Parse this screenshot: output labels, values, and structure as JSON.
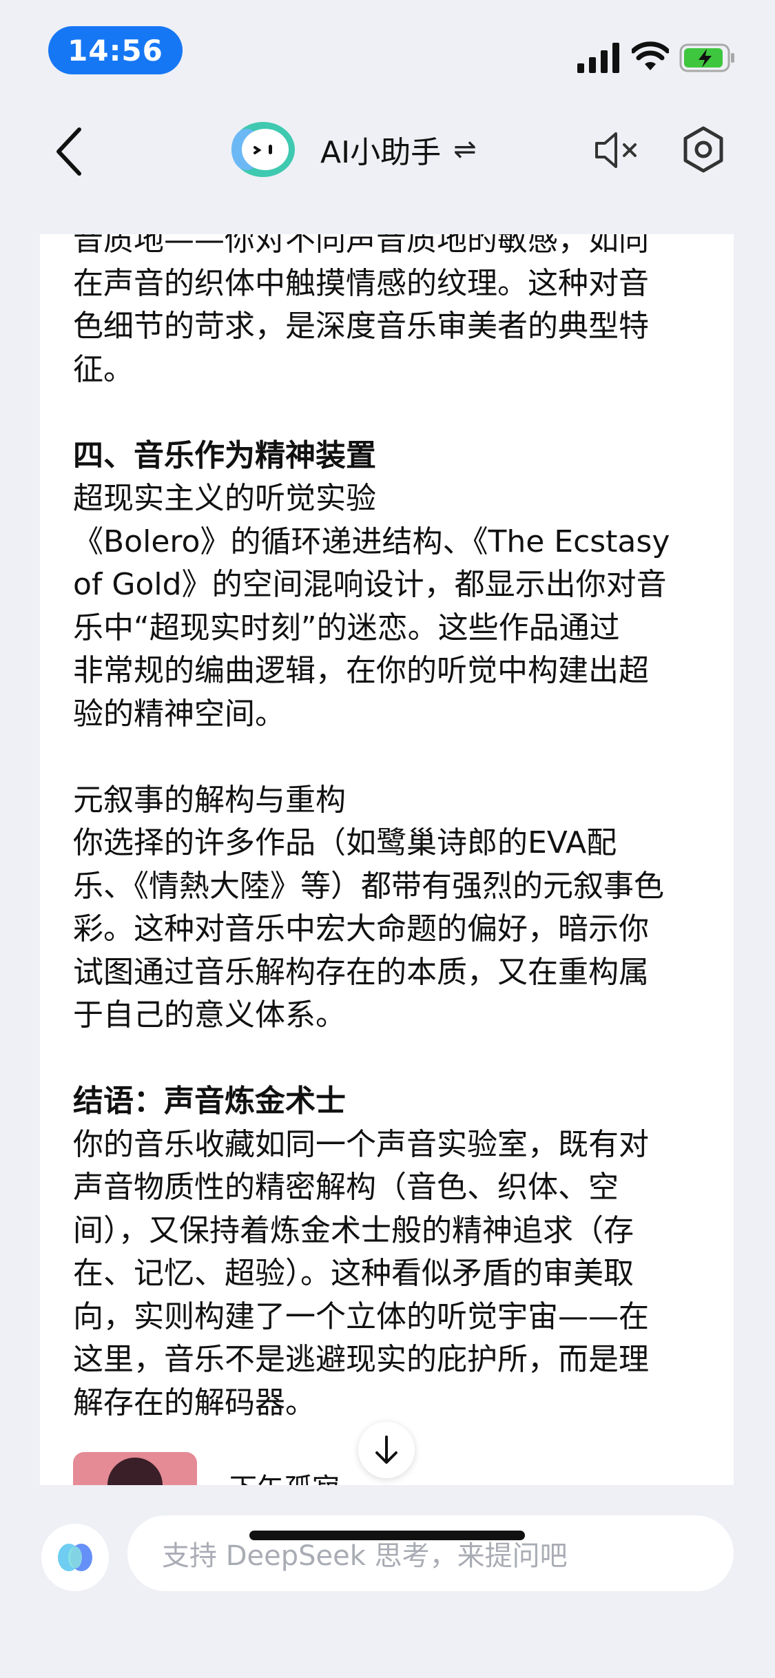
{
  "status": {
    "time": "14:56"
  },
  "header": {
    "title": "AI小助手",
    "swap_symbol": "⇌"
  },
  "content": {
    "lines": [
      "音质地——你对不同声音质地的敏感，如同",
      "在声音的织体中触摸情感的纹理。这种对音",
      "色细节的苛求，是深度音乐审美者的典型特",
      "征。",
      "",
      "四、音乐作为精神装置",
      "超现实主义的听觉实验",
      "《Bolero》的循环递进结构、《The Ecstasy",
      "of Gold》的空间混响设计，都显示出你对音",
      "乐中“超现实时刻”的迷恋。这些作品通过",
      "非常规的编曲逻辑，在你的听觉中构建出超",
      "验的精神空间。",
      "",
      "元叙事的解构与重构",
      "你选择的许多作品（如鹭巢诗郎的EVA配",
      "乐、《情熱大陸》等）都带有强烈的元叙事色",
      "彩。这种对音乐中宏大命题的偏好，暗示你",
      "试图通过音乐解构存在的本质，又在重构属",
      "于自己的意义体系。",
      "",
      "结语：声音炼金术士",
      "你的音乐收藏如同一个声音实验室，既有对",
      "声音物质性的精密解构（音色、织体、空",
      "间），又保持着炼金术士般的精神追求（存",
      "在、记忆、超验）。这种看似矛盾的审美取",
      "向，实则构建了一个立体的听觉宇宙——在",
      "这里，音乐不是逃避现实的庇护所，而是理",
      "解存在的解码器。"
    ],
    "album_partial_text": "下午孤寂"
  },
  "input": {
    "placeholder": "支持 DeepSeek 思考，来提问吧"
  },
  "colors": {
    "accent": "#1677f5",
    "battery_green": "#3ec63e",
    "background": "#eef0f5"
  },
  "icons": [
    "signal-icon",
    "wifi-icon",
    "battery-icon",
    "back-arrow-icon",
    "assistant-logo-icon",
    "mute-speaker-icon",
    "settings-hexagon-icon",
    "arrow-down-icon",
    "ai-orb-icon"
  ]
}
